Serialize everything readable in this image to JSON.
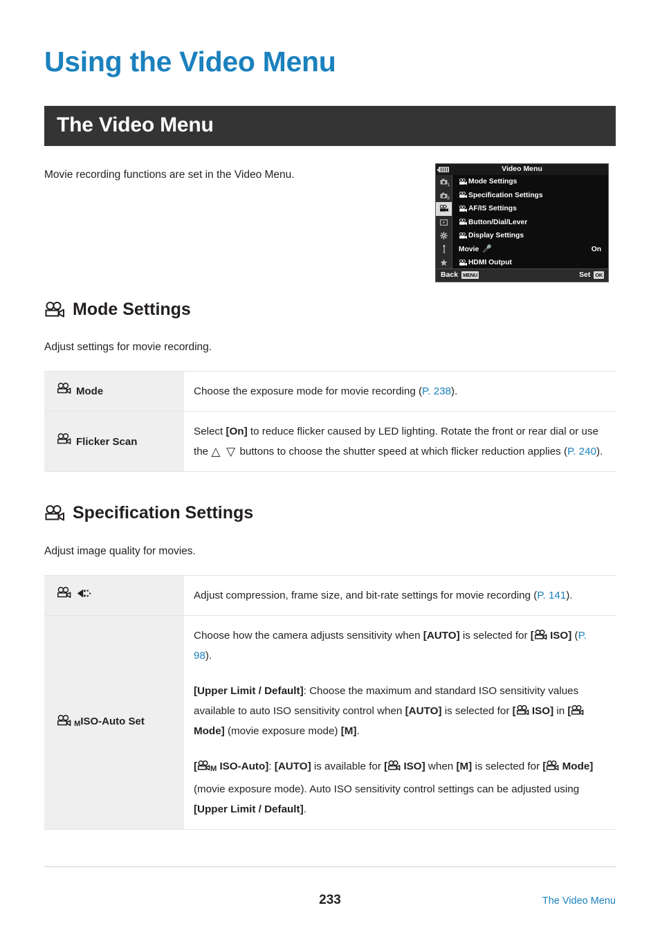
{
  "page": {
    "chapter_title": "Using the Video Menu",
    "section_banner": "The Video Menu",
    "intro": "Movie recording functions are set in the Video Menu.",
    "page_number": "233",
    "footer_link": "The Video Menu"
  },
  "colors": {
    "accent_blue": "#1b81bd",
    "banner_dark": "#343434",
    "label_cell_gray": "#efefef",
    "row_border": "#e3e3e3"
  },
  "camera_menu": {
    "title": "Video Menu",
    "battery_icon": "battery-icon",
    "tabs": [
      {
        "icon": "camera-icon",
        "sub": "1",
        "selected": false
      },
      {
        "icon": "camera-icon",
        "sub": "2",
        "selected": false
      },
      {
        "icon": "movie-camera-icon",
        "sub": "",
        "selected": true
      },
      {
        "icon": "playback-icon",
        "sub": "",
        "selected": false
      },
      {
        "icon": "gear-icon",
        "sub": "",
        "selected": false
      },
      {
        "icon": "wrench-icon",
        "sub": "",
        "selected": false
      },
      {
        "icon": "star-icon",
        "sub": "",
        "selected": false
      }
    ],
    "items": [
      {
        "icon": "movie-camera-icon",
        "label": "Mode Settings",
        "value": ""
      },
      {
        "icon": "movie-camera-icon",
        "label": "Specification Settings",
        "value": ""
      },
      {
        "icon": "movie-camera-icon",
        "label": "AF/IS Settings",
        "value": ""
      },
      {
        "icon": "movie-camera-icon",
        "label": "Button/Dial/Lever",
        "value": ""
      },
      {
        "icon": "movie-camera-icon",
        "label": "Display Settings",
        "value": ""
      },
      {
        "icon": "microphone-icon",
        "label": "Movie",
        "value": "On"
      },
      {
        "icon": "movie-camera-icon",
        "label": "HDMI Output",
        "value": ""
      }
    ],
    "footer": {
      "back_label": "Back",
      "back_key": "MENU",
      "set_label": "Set",
      "set_key": "OK"
    }
  },
  "sections": [
    {
      "id": "mode-settings",
      "icon": "movie-camera-icon",
      "heading": "Mode Settings",
      "description": "Adjust settings for movie recording.",
      "rows": [
        {
          "label_icon": "movie-camera-icon",
          "label": "Mode",
          "paragraphs": [
            "Choose the exposure mode for movie recording (P. 238)."
          ],
          "page_ref": "P. 238"
        },
        {
          "label_icon": "movie-camera-icon",
          "label": "Flicker Scan",
          "paragraphs": [
            "Select [On] to reduce flicker caused by LED lighting. Rotate the front or rear dial or use the △ ▽ buttons to choose the shutter speed at which flicker reduction applies (P. 240)."
          ],
          "page_ref": "P. 240"
        }
      ]
    },
    {
      "id": "specification-settings",
      "icon": "movie-camera-icon",
      "heading": "Specification Settings",
      "description": "Adjust image quality for movies.",
      "rows": [
        {
          "label_icon": "movie-camera-icon",
          "label_icon_2": "image-quality-icon",
          "label": "",
          "paragraphs": [
            "Adjust compression, frame size, and bit-rate settings for movie recording (P. 141)."
          ],
          "page_ref": "P. 141"
        },
        {
          "label_icon": "movie-camera-icon",
          "label": "ISO-Auto Set",
          "label_sub": "M",
          "paragraphs": [
            "Choose how the camera adjusts sensitivity when [AUTO] is selected for [ ISO] (P. 98).",
            "[Upper Limit / Default]: Choose the maximum and standard ISO sensitivity values available to auto ISO sensitivity control when [AUTO] is selected for [ ISO] in [ Mode] (movie exposure mode) [M].",
            "[ M ISO-Auto]: [AUTO] is available for [ ISO] when [M] is selected for [ Mode] (movie exposure mode). Auto ISO sensitivity control settings can be adjusted using [Upper Limit / Default]."
          ],
          "page_ref": "P. 98"
        }
      ]
    }
  ],
  "text_fragments": {
    "mode_desc_a": "Choose the exposure mode for movie recording (",
    "mode_ref": "P. 238",
    "mode_desc_b": ").",
    "flicker_a": "Select ",
    "flicker_on": "[On]",
    "flicker_b": " to reduce flicker caused by LED lighting. Rotate the front or rear dial or use the ",
    "flicker_tri": "△ ▽",
    "flicker_c": " buttons to choose the shutter speed at which flicker reduction applies (",
    "flicker_ref": "P. 240",
    "flicker_d": ").",
    "quality_a": "Adjust compression, frame size, and bit-rate settings for movie recording (",
    "quality_ref": "P. 141",
    "quality_b": ").",
    "iso_p1_a": "Choose how the camera adjusts sensitivity when ",
    "iso_auto": "[AUTO]",
    "iso_p1_b": " is selected for ",
    "iso_bracket_open": "[",
    "iso_word": " ISO]",
    "iso_p1_c": " (",
    "iso_ref_98": "P. 98",
    "iso_p1_d": ").",
    "iso_p2_upper": "[Upper Limit / Default]",
    "iso_p2_a": ": Choose the maximum and standard ISO sensitivity values available to auto ISO sensitivity control when ",
    "iso_p2_b": " is selected for ",
    "iso_p2_in": " in ",
    "iso_mode_word": " Mode]",
    "iso_p2_c": " (movie exposure mode) ",
    "iso_m": "[M]",
    "iso_p2_d": ".",
    "iso_p3_open": "[",
    "iso_p3_sub": "M",
    "iso_p3_name": " ISO-Auto]",
    "iso_p3_a": ": ",
    "iso_p3_b": " is available for ",
    "iso_p3_c": " when ",
    "iso_p3_d": " is selected for ",
    "iso_p3_e": " (movie exposure mode). Auto ISO sensitivity control settings can be adjusted using ",
    "iso_p3_f": "."
  }
}
